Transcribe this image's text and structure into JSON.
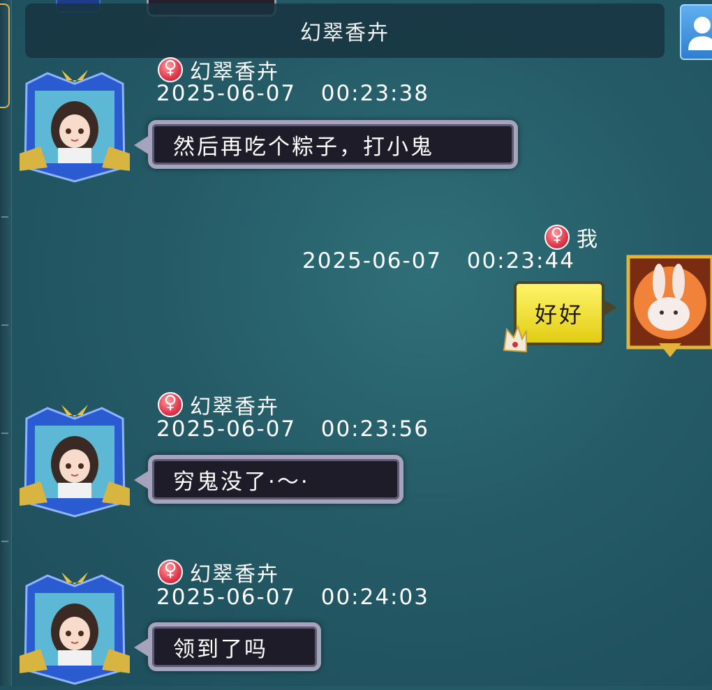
{
  "chat": {
    "title": "幻翠香卉"
  },
  "messages": [
    {
      "sender": "幻翠香卉",
      "timestamp": "2025-06-07   00:23:38",
      "text": "然后再吃个粽子，打小鬼",
      "side": "left"
    },
    {
      "sender": "我",
      "timestamp": "2025-06-07   00:23:44",
      "text": "好好",
      "side": "right"
    },
    {
      "sender": "幻翠香卉",
      "timestamp": "2025-06-07   00:23:56",
      "text": "穷鬼没了·～·",
      "side": "left"
    },
    {
      "sender": "幻翠香卉",
      "timestamp": "2025-06-07   00:24:03",
      "text": "领到了吗",
      "side": "left"
    }
  ],
  "icons": {
    "gender": "female-symbol-icon",
    "profile": "user-profile-icon",
    "avatar_other": "anime-girl-avatar",
    "avatar_self": "rabbit-avatar"
  },
  "colors": {
    "background": "#245a66",
    "bubble_other": "#1d1c28",
    "bubble_self": "#f2e23a",
    "gender_badge": "#e0364a"
  }
}
